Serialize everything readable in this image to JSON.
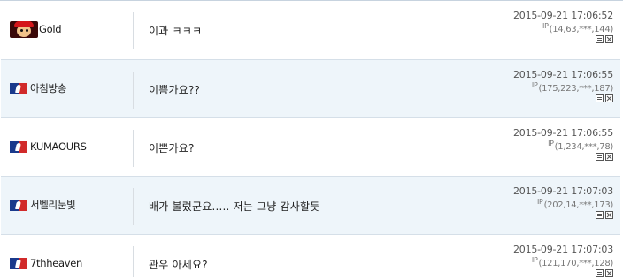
{
  "comments": [
    {
      "author": "Gold",
      "icon": "avatar-icon",
      "text": "이과 ㅋㅋㅋ",
      "date": "2015-09-21 17:06:52",
      "ip_label": "IP",
      "ip": "(14,63,***,144)"
    },
    {
      "author": "아침방송",
      "icon": "mlb-icon",
      "text": "이쁨가요??",
      "date": "2015-09-21 17:06:55",
      "ip_label": "IP",
      "ip": "(175,223,***,187)"
    },
    {
      "author": "KUMAOURS",
      "icon": "mlb-icon",
      "text": "이쁜가요?",
      "date": "2015-09-21 17:06:55",
      "ip_label": "IP",
      "ip": "(1,234,***,78)"
    },
    {
      "author": "서벨리눈빛",
      "icon": "mlb-icon",
      "text": "배가 불렀군요..... 저는 그냥 감사할듯",
      "date": "2015-09-21 17:07:03",
      "ip_label": "IP",
      "ip": "(202,14,***,173)"
    },
    {
      "author": "7thheaven",
      "icon": "mlb-icon",
      "text": "관우 아세요?",
      "date": "2015-09-21 17:07:03",
      "ip_label": "IP",
      "ip": "(121,170,***,128)"
    }
  ],
  "colors": {
    "alt_row": "#eef5fa",
    "border": "#d5dfe8",
    "mlb_blue": "#1a3a8c",
    "mlb_red": "#d12a2a"
  }
}
